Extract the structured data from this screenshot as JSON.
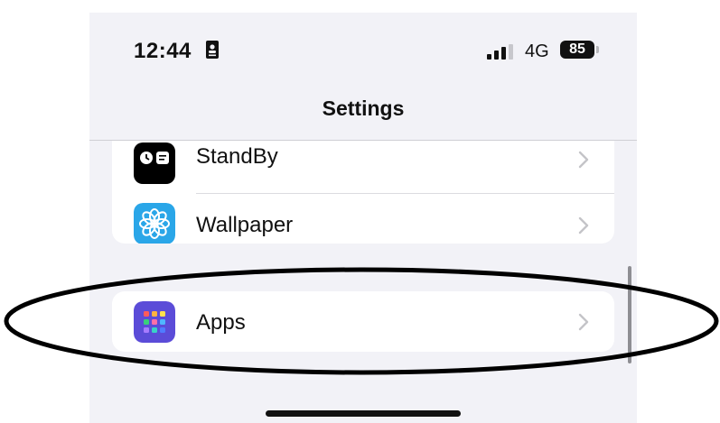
{
  "status_bar": {
    "time": "12:44",
    "network": "4G",
    "battery": "85"
  },
  "nav": {
    "title": "Settings"
  },
  "list": {
    "items": [
      {
        "label": "StandBy",
        "icon": "standby-icon"
      },
      {
        "label": "Wallpaper",
        "icon": "wallpaper-icon"
      },
      {
        "label": "Apps",
        "icon": "apps-icon"
      }
    ]
  },
  "colors": {
    "background": "#f2f2f7",
    "wallpaper_icon": "#2aa6e8",
    "apps_icon": "#5b4cd8",
    "annotation": "#000000"
  }
}
